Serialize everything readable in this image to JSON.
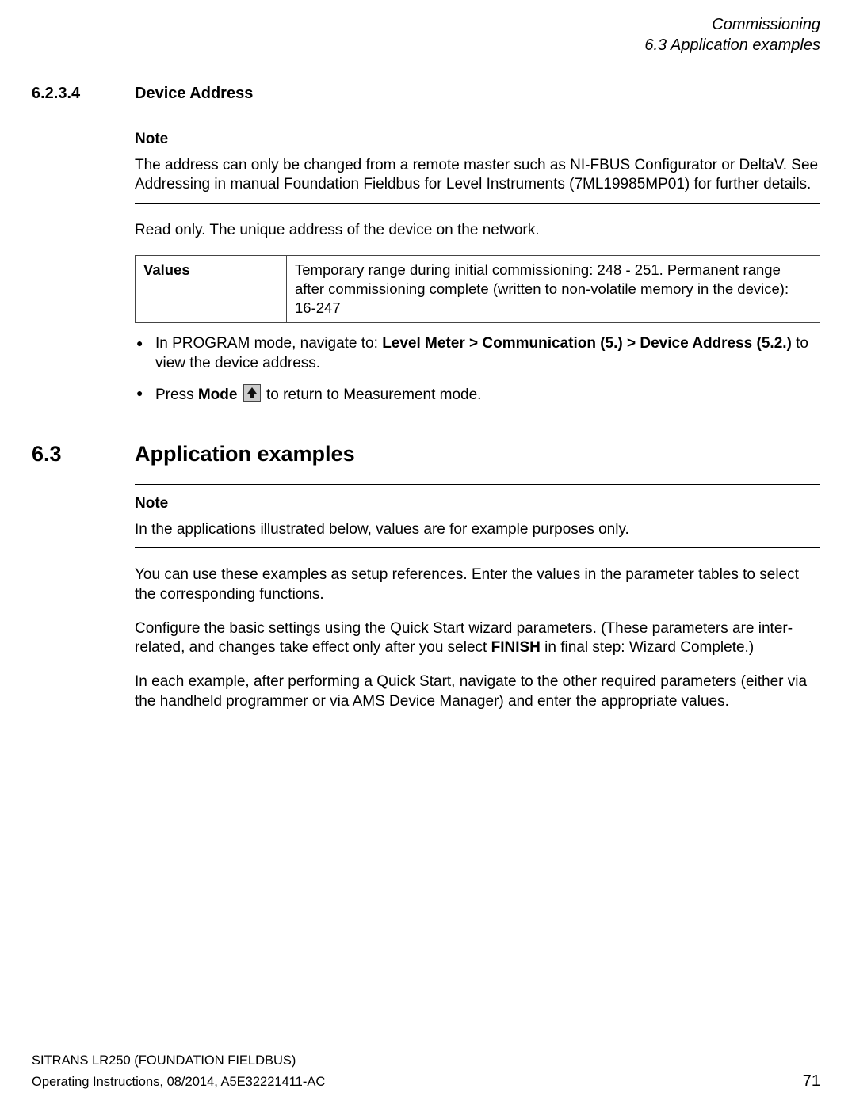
{
  "header": {
    "line1": "Commissioning",
    "line2": "6.3 Application examples"
  },
  "section1": {
    "number": "6.2.3.4",
    "title": "Device Address",
    "note": {
      "label": "Note",
      "text": "The address can only be changed from a remote master such as NI-FBUS Configurator or DeltaV. See Addressing in manual Foundation Fieldbus for Level Instruments (7ML19985MP01) for further details."
    },
    "para1": "Read only. The unique address of the device on the network.",
    "table": {
      "header": "Values",
      "cell": "Temporary range during initial commissioning: 248 - 251. Permanent range after commissioning complete (written to non-volatile memory in the device): 16-247"
    },
    "bullets": {
      "b1_pre": "In PROGRAM mode, navigate to: ",
      "b1_bold": "Level Meter > Communication (5.) > Device Address (5.2.)",
      "b1_post": " to view the device address.",
      "b2_pre": "Press ",
      "b2_mode": "Mode",
      "b2_post": " to return to Measurement mode."
    }
  },
  "section2": {
    "number": "6.3",
    "title": "Application examples",
    "note": {
      "label": "Note",
      "text": "In the applications illustrated below, values are for example purposes only."
    },
    "para1": "You can use these examples as setup references. Enter the values in the parameter tables to select the corresponding functions.",
    "para2_pre": "Configure the basic settings using the Quick Start wizard parameters. (These parameters are inter-related, and changes take effect only after you select ",
    "para2_bold": "FINISH",
    "para2_post": " in final step: Wizard Complete.)",
    "para3": "In each example, after performing a Quick Start, navigate to the other required parameters (either via the handheld programmer or via AMS Device Manager) and enter the appropriate values."
  },
  "footer": {
    "line1": "SITRANS LR250 (FOUNDATION FIELDBUS)",
    "line2": "Operating Instructions, 08/2014, A5E32221411-AC",
    "page": "71"
  }
}
